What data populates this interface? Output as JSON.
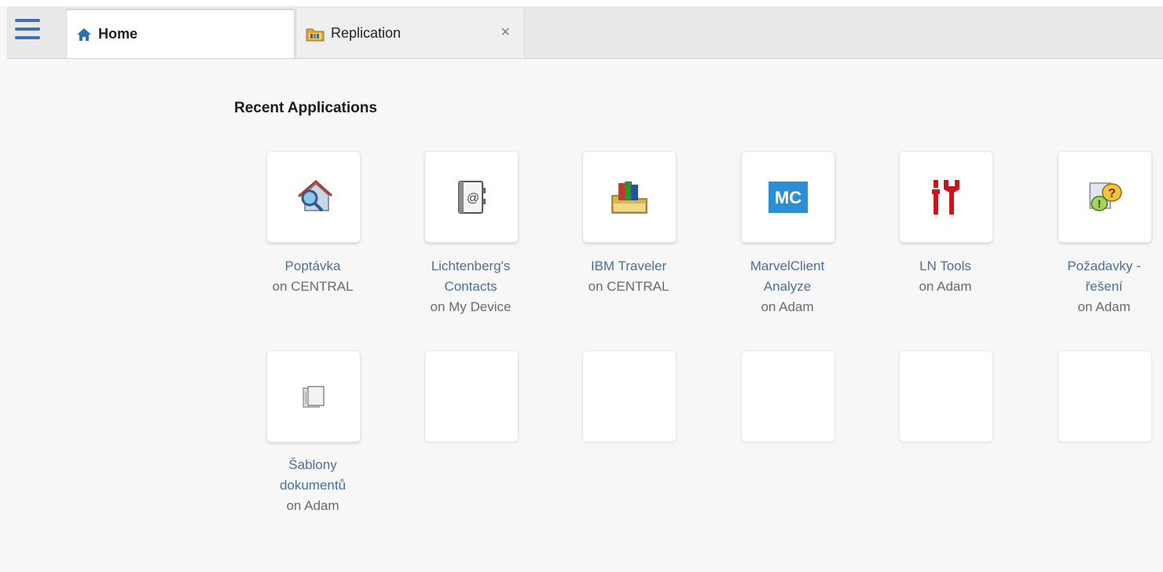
{
  "tabs": [
    {
      "label": "Home",
      "icon": "home-icon"
    },
    {
      "label": "Replication",
      "icon": "folder-icon",
      "close": "×"
    }
  ],
  "section_title": "Recent Applications",
  "apps": [
    {
      "name1": "Poptávka",
      "name2": "",
      "location": "on CENTRAL",
      "icon": "magnifier-house-icon"
    },
    {
      "name1": "Lichtenberg's",
      "name2": "Contacts",
      "location": "on My Device",
      "icon": "address-book-icon"
    },
    {
      "name1": "IBM Traveler",
      "name2": "",
      "location": "on CENTRAL",
      "icon": "traveler-icon"
    },
    {
      "name1": "MarvelClient",
      "name2": "Analyze",
      "location": "on Adam",
      "icon": "mc-icon",
      "icon_text": "MC"
    },
    {
      "name1": "LN Tools",
      "name2": "",
      "location": "on Adam",
      "icon": "tools-icon"
    },
    {
      "name1": "Požadavky -",
      "name2": "řešení",
      "location": "on Adam",
      "icon": "requests-icon"
    },
    {
      "name1": "Šablony",
      "name2": "dokumentů",
      "location": "on Adam",
      "icon": "template-icon"
    }
  ],
  "colors": {
    "accent": "#3e72b6",
    "link": "#4a6f9c",
    "tools_red": "#d0131b",
    "mc_blue": "#2b8fd6"
  }
}
